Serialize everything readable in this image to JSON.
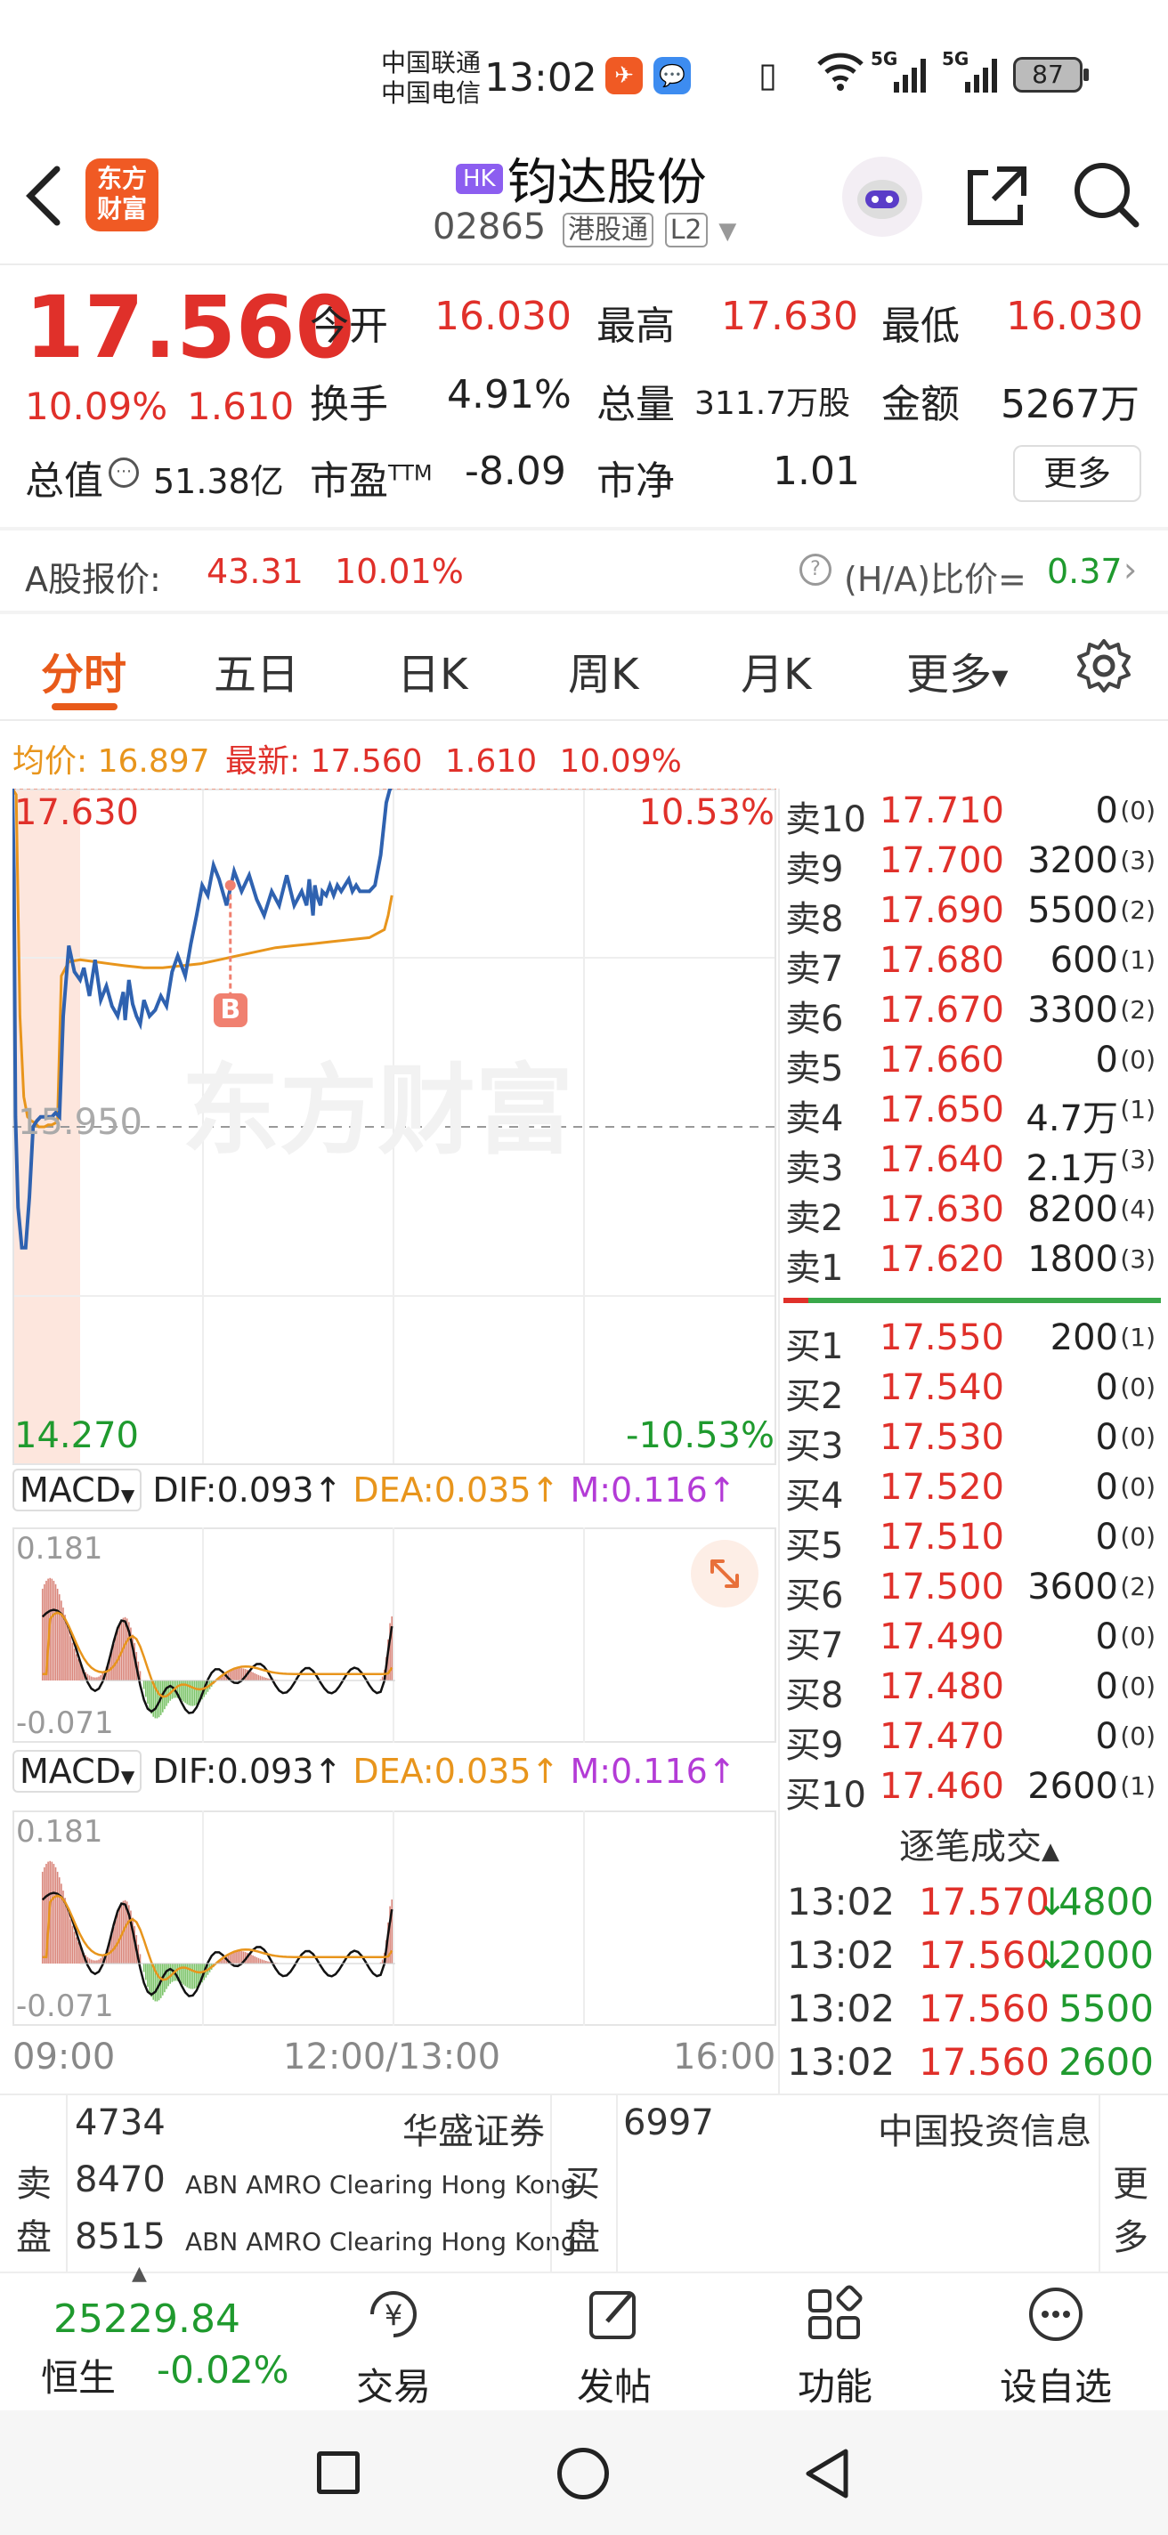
{
  "status_bar": {
    "carrier1": "中国联通",
    "carrier2": "中国电信",
    "time": "13:02",
    "net1": "5G",
    "net2": "5G",
    "battery": "87"
  },
  "header": {
    "logo_line1": "东方",
    "logo_line2": "财富",
    "market_badge": "HK",
    "stock_name": "钧达股份",
    "stock_code": "02865",
    "connect_tag": "港股通",
    "level_tag": "L2"
  },
  "quote": {
    "price": "17.560",
    "pct": "10.09%",
    "change": "1.610",
    "open_label": "今开",
    "open": "16.030",
    "high_label": "最高",
    "high": "17.630",
    "low_label": "最低",
    "low": "16.030",
    "turnover_label": "换手",
    "turnover": "4.91%",
    "volume_label": "总量",
    "volume": "311.7万股",
    "amount_label": "金额",
    "amount": "5267万",
    "mktcap_label": "总值",
    "mktcap": "51.38亿",
    "pe_label": "市盈",
    "pe_sup": "TTM",
    "pe": "-8.09",
    "pb_label": "市净",
    "pb": "1.01",
    "more": "更多"
  },
  "a_share": {
    "label": "A股报价:",
    "price": "43.31",
    "pct": "10.01%",
    "ratio_label": "(H/A)比价=",
    "ratio": "0.37"
  },
  "tabs": [
    "分时",
    "五日",
    "日K",
    "周K",
    "月K",
    "更多"
  ],
  "summary": {
    "avg_label": "均价:",
    "avg": "16.897",
    "latest_label": "最新:",
    "latest": "17.560",
    "change": "1.610",
    "pct": "10.09%"
  },
  "chart_data": {
    "type": "line",
    "title": "",
    "y_max_label": "17.630",
    "y_mid_label": "15.950",
    "y_min_label": "14.270",
    "pct_max_label": "10.53%",
    "pct_min_label": "-10.53%",
    "ylim": [
      14.27,
      17.63
    ],
    "prev_close": 15.95,
    "x_labels": [
      "09:00",
      "12:00/13:00",
      "16:00"
    ],
    "watermark": "东方财富",
    "trade_marker": "B",
    "series": [
      {
        "name": "price",
        "color": "#2f62b0",
        "x": [
          0,
          0.4,
          0.8,
          1.5,
          2.5,
          3.5,
          4.5,
          5.5,
          6.5,
          7.5,
          8.5,
          9.5,
          10.5,
          11.5,
          12.5,
          13.5,
          15,
          16.5,
          18,
          19,
          20.5,
          22,
          23.5,
          25,
          26.5,
          28,
          29.5,
          30,
          31,
          32,
          33,
          34,
          35,
          36.5,
          38,
          39.5,
          41,
          42.5,
          44,
          46,
          47.5,
          49,
          50.5,
          52,
          53.5,
          55,
          57,
          59,
          61,
          63,
          65,
          67,
          69,
          71,
          73,
          75,
          77,
          78.3,
          79,
          80,
          80.5,
          81,
          82,
          82.5,
          83.5,
          84.5,
          85.5,
          86.5,
          87.5,
          88.5,
          89.5,
          90.5,
          91.5,
          92.5,
          93.5,
          95,
          96.5,
          98,
          99.5,
          100.5,
          101
        ],
        "values": [
          17.63,
          17.2,
          16.0,
          15.55,
          15.35,
          15.35,
          15.6,
          15.95,
          15.98,
          16.0,
          16.0,
          16.0,
          16.0,
          16.02,
          16.0,
          16.5,
          16.85,
          16.72,
          16.68,
          16.74,
          16.6,
          16.78,
          16.58,
          16.65,
          16.55,
          16.5,
          16.62,
          16.48,
          16.68,
          16.56,
          16.5,
          16.46,
          16.58,
          16.5,
          16.53,
          16.6,
          16.55,
          16.72,
          16.8,
          16.7,
          16.86,
          17.0,
          17.15,
          17.1,
          17.25,
          17.18,
          17.05,
          17.22,
          17.12,
          17.2,
          17.08,
          17.0,
          17.12,
          17.05,
          17.2,
          17.05,
          17.12,
          17.05,
          17.18,
          17.0,
          17.15,
          17.1,
          17.05,
          17.12,
          17.1,
          17.15,
          17.1,
          17.15,
          17.12,
          17.15,
          17.18,
          17.12,
          17.15,
          17.12,
          17.12,
          17.12,
          17.15,
          17.3,
          17.56,
          17.63,
          17.63
        ]
      },
      {
        "name": "avg",
        "color": "#e8951c",
        "x": [
          0,
          1,
          2,
          3,
          4,
          5,
          6,
          7,
          8,
          8.5,
          9.5,
          10.5,
          11.5,
          12,
          13,
          15,
          18,
          22,
          26,
          30,
          35,
          40,
          45,
          50,
          55,
          60,
          65,
          70,
          75,
          80,
          85,
          90,
          95,
          99,
          100,
          101
        ],
        "values": [
          17.63,
          17.6,
          16.5,
          16.1,
          16.0,
          15.98,
          15.97,
          15.95,
          15.95,
          15.95,
          15.96,
          15.96,
          15.97,
          15.98,
          16.7,
          16.77,
          16.78,
          16.77,
          16.76,
          16.75,
          16.74,
          16.74,
          16.75,
          16.76,
          16.78,
          16.8,
          16.82,
          16.84,
          16.85,
          16.86,
          16.87,
          16.88,
          16.89,
          16.93,
          17.0,
          17.1
        ]
      }
    ],
    "macd": {
      "label": "MACD",
      "dif_label": "DIF:0.093",
      "dea_label": "DEA:0.035",
      "m_label": "M:0.116",
      "y_max_label": "0.181",
      "y_min_label": "-0.071"
    }
  },
  "order_book": {
    "asks": [
      {
        "label": "卖10",
        "price": "17.710",
        "vol": "0",
        "cnt": "(0)"
      },
      {
        "label": "卖9",
        "price": "17.700",
        "vol": "3200",
        "cnt": "(3)"
      },
      {
        "label": "卖8",
        "price": "17.690",
        "vol": "5500",
        "cnt": "(2)"
      },
      {
        "label": "卖7",
        "price": "17.680",
        "vol": "600",
        "cnt": "(1)"
      },
      {
        "label": "卖6",
        "price": "17.670",
        "vol": "3300",
        "cnt": "(2)"
      },
      {
        "label": "卖5",
        "price": "17.660",
        "vol": "0",
        "cnt": "(0)"
      },
      {
        "label": "卖4",
        "price": "17.650",
        "vol": "4.7万",
        "cnt": "(1)"
      },
      {
        "label": "卖3",
        "price": "17.640",
        "vol": "2.1万",
        "cnt": "(3)"
      },
      {
        "label": "卖2",
        "price": "17.630",
        "vol": "8200",
        "cnt": "(4)"
      },
      {
        "label": "卖1",
        "price": "17.620",
        "vol": "1800",
        "cnt": "(3)"
      }
    ],
    "bids": [
      {
        "label": "买1",
        "price": "17.550",
        "vol": "200",
        "cnt": "(1)"
      },
      {
        "label": "买2",
        "price": "17.540",
        "vol": "0",
        "cnt": "(0)"
      },
      {
        "label": "买3",
        "price": "17.530",
        "vol": "0",
        "cnt": "(0)"
      },
      {
        "label": "买4",
        "price": "17.520",
        "vol": "0",
        "cnt": "(0)"
      },
      {
        "label": "买5",
        "price": "17.510",
        "vol": "0",
        "cnt": "(0)"
      },
      {
        "label": "买6",
        "price": "17.500",
        "vol": "3600",
        "cnt": "(2)"
      },
      {
        "label": "买7",
        "price": "17.490",
        "vol": "0",
        "cnt": "(0)"
      },
      {
        "label": "买8",
        "price": "17.480",
        "vol": "0",
        "cnt": "(0)"
      },
      {
        "label": "买9",
        "price": "17.470",
        "vol": "0",
        "cnt": "(0)"
      },
      {
        "label": "买10",
        "price": "17.460",
        "vol": "2600",
        "cnt": "(1)"
      }
    ]
  },
  "ticks": {
    "title": "逐笔成交",
    "rows": [
      {
        "time": "13:02",
        "price": "17.570",
        "arrow": "↓",
        "vol": "4800"
      },
      {
        "time": "13:02",
        "price": "17.560",
        "arrow": "↓",
        "vol": "2000"
      },
      {
        "time": "13:02",
        "price": "17.560",
        "arrow": "",
        "vol": "5500"
      },
      {
        "time": "13:02",
        "price": "17.560",
        "arrow": "",
        "vol": "2600"
      }
    ]
  },
  "brokers": {
    "sell_label1": "卖",
    "sell_label2": "盘",
    "buy_label1": "买",
    "buy_label2": "盘",
    "more1": "更",
    "more2": "多",
    "sell": [
      {
        "code": "4734",
        "name": "华盛证券"
      },
      {
        "code": "8470",
        "name": "ABN AMRO Clearing Hong Kong"
      },
      {
        "code": "8515",
        "name": "ABN AMRO Clearing Hong Kong"
      }
    ],
    "buy": [
      {
        "code": "6997",
        "name": "中国投资信息"
      }
    ]
  },
  "bottom_nav": {
    "index_value": "25229.84",
    "index_name": "恒生",
    "index_pct": "-0.02%",
    "items": [
      "交易",
      "发帖",
      "功能",
      "设自选"
    ]
  }
}
